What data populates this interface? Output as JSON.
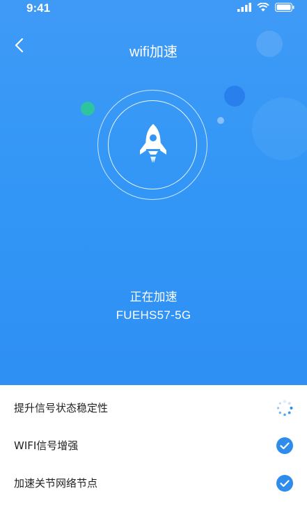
{
  "status_bar": {
    "time": "9:41"
  },
  "nav": {
    "title": "wifi加速"
  },
  "boost": {
    "status_text": "正在加速",
    "ssid": "FUEHS57-5G"
  },
  "tasks": [
    {
      "label": "提升信号状态稳定性",
      "state": "loading"
    },
    {
      "label": "WIFI信号增强",
      "state": "done"
    },
    {
      "label": "加速关节网络节点",
      "state": "done"
    }
  ],
  "colors": {
    "accent": "#2f8ff3",
    "check": "#2e8cec",
    "teal_dot": "#2ec4a0"
  }
}
